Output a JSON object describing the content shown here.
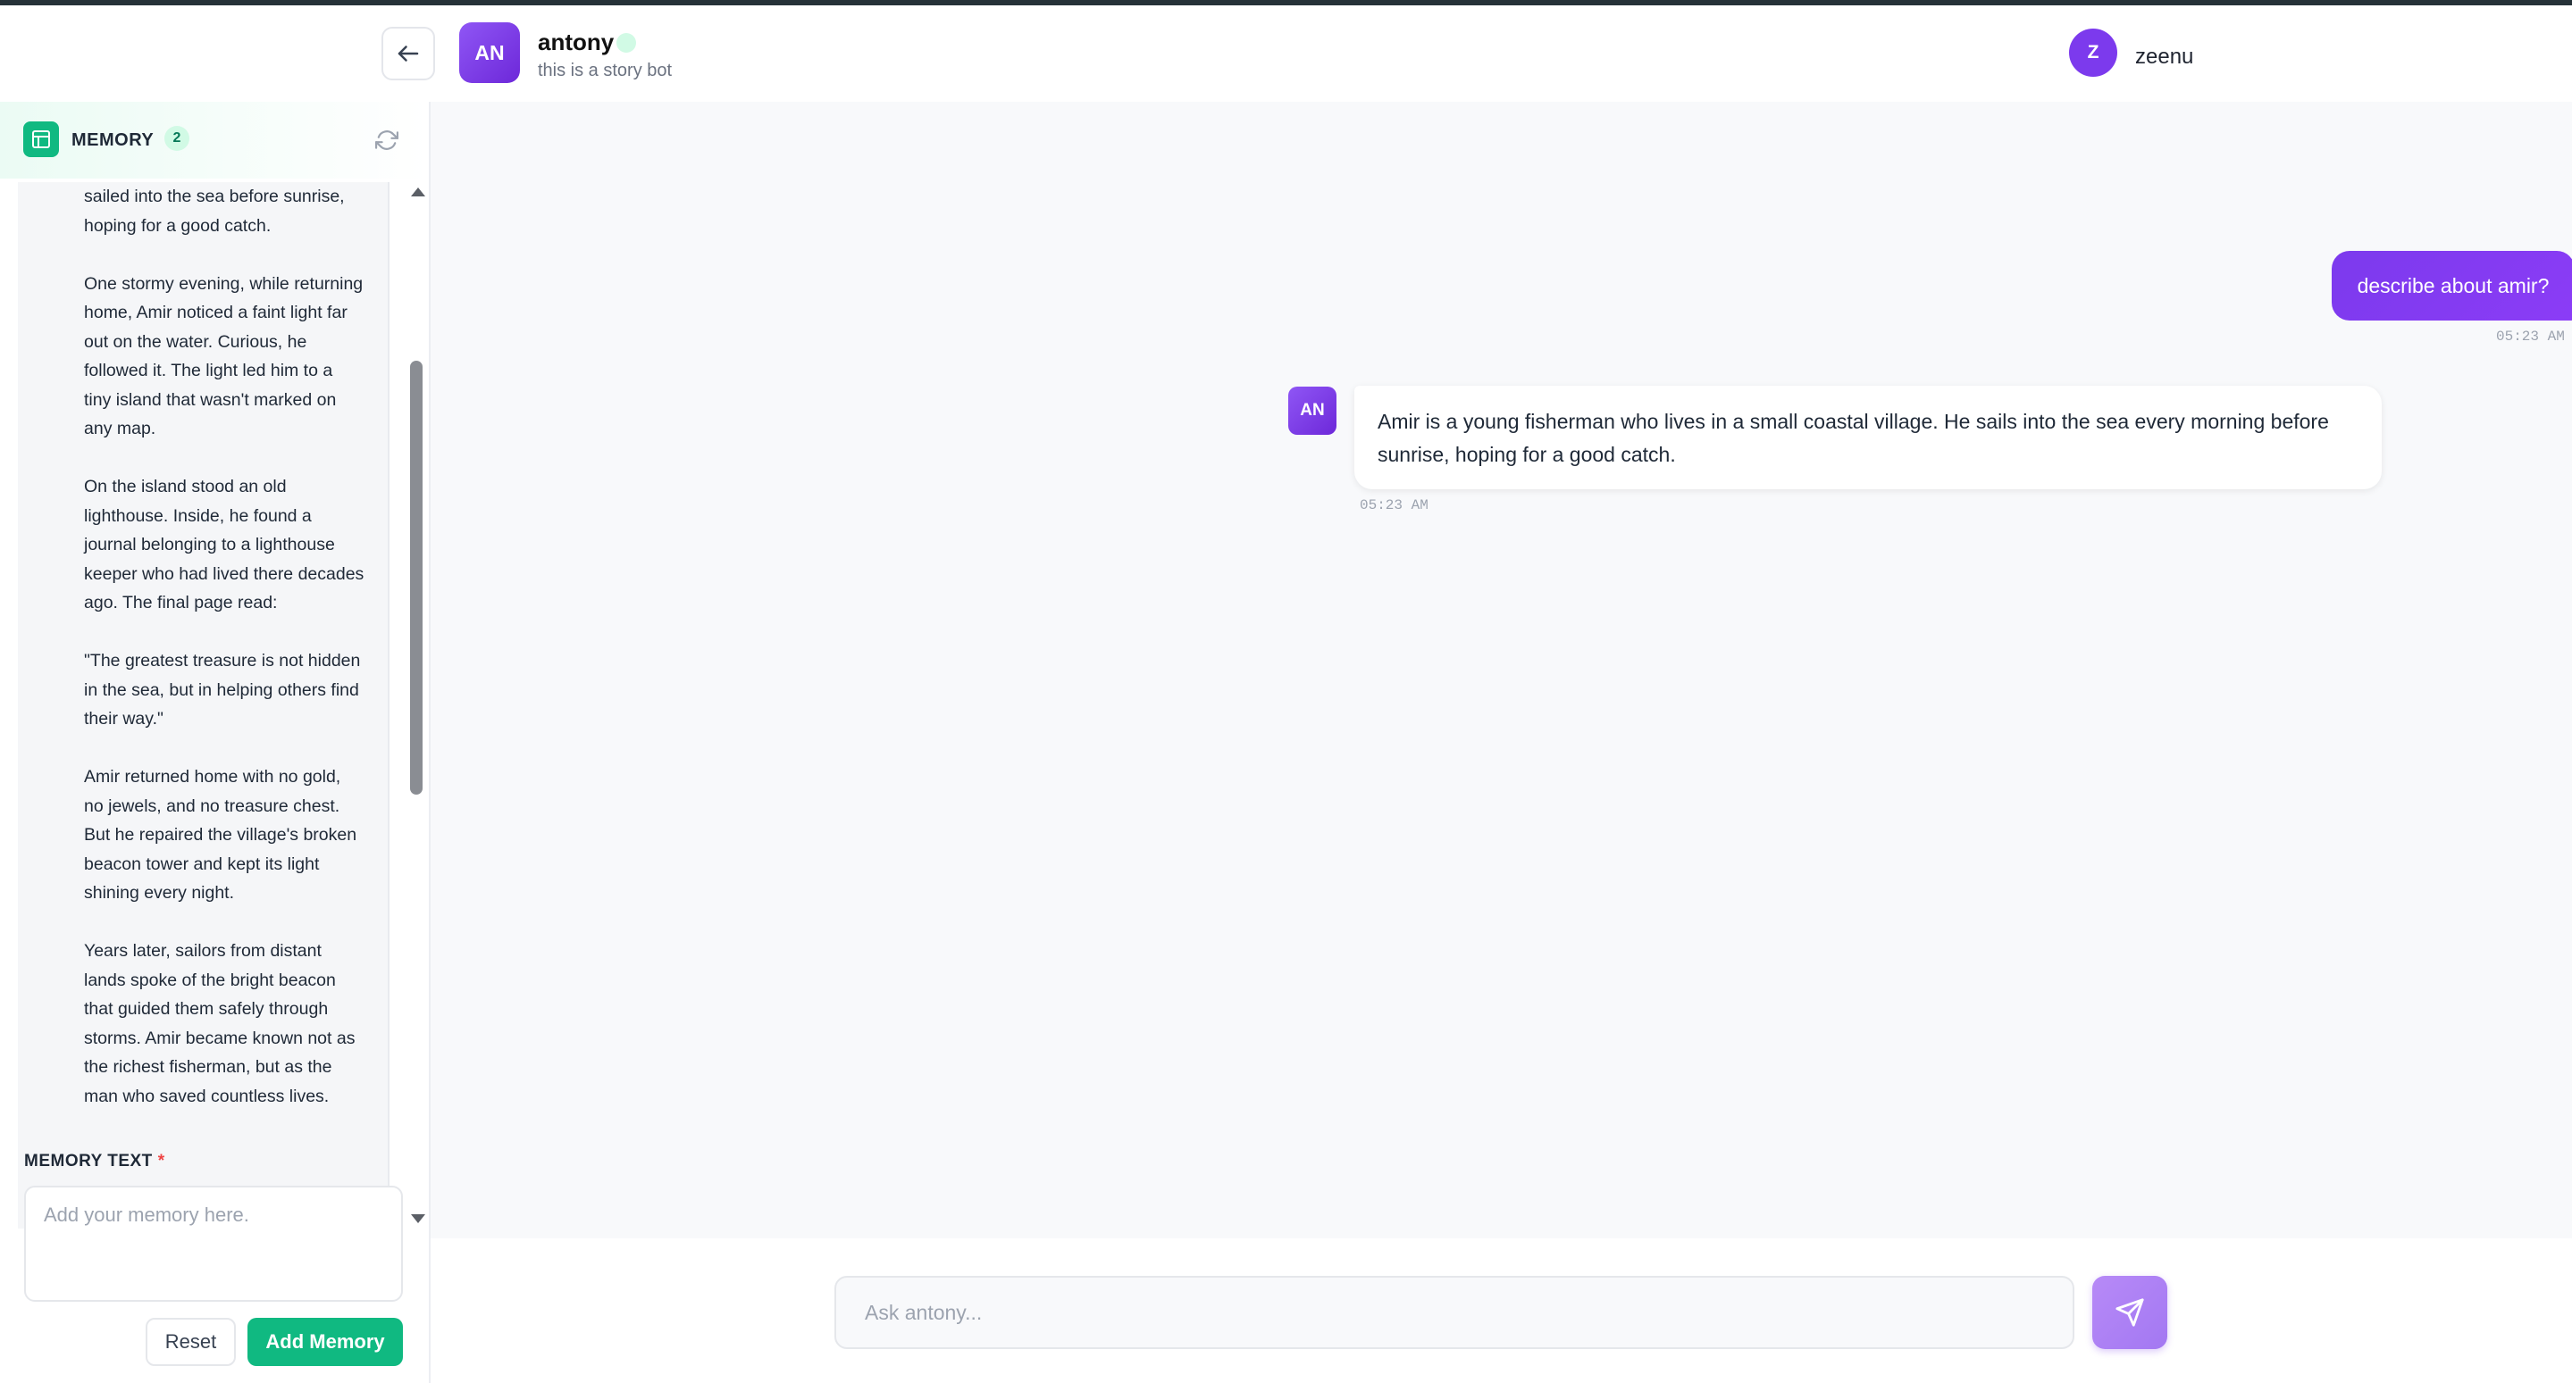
{
  "header": {
    "bot_initials": "AN",
    "bot_name": "antony",
    "bot_description": "this is a story bot",
    "user_initial": "Z",
    "user_name": "zeenu"
  },
  "memory": {
    "title": "MEMORY",
    "count": "2",
    "text": "sailed into the sea before sunrise,\nhoping for a good catch.\n\nOne stormy evening, while returning\nhome, Amir noticed a faint light far\nout on the water. Curious, he\nfollowed it. The light led him to a\ntiny island that wasn't marked on\nany map.\n\nOn the island stood an old\nlighthouse. Inside, he found a\njournal belonging to a lighthouse\nkeeper who had lived there decades\nago. The final page read:\n\n\"The greatest treasure is not hidden\nin the sea, but in helping others find\ntheir way.\"\n\nAmir returned home with no gold,\nno jewels, and no treasure chest.\nBut he repaired the village's broken\nbeacon tower and kept its light\nshining every night.\n\nYears later, sailors from distant\nlands spoke of the bright beacon\nthat guided them safely through\nstorms. Amir became known not as\nthe richest fisherman, but as the\nman who saved countless lives.",
    "form_label": "MEMORY TEXT",
    "required_mark": "*",
    "textarea_value": "",
    "textarea_placeholder": "Add your memory here.",
    "reset_label": "Reset",
    "add_label": "Add Memory"
  },
  "chat": {
    "messages": [
      {
        "role": "user",
        "text": "describe about amir?",
        "time": "05:23 AM"
      },
      {
        "role": "bot",
        "avatar": "AN",
        "text": "Amir is a young fisherman who lives in a small coastal village. He sails into the sea every morning before sunrise, hoping for a good catch.",
        "time": "05:23 AM"
      }
    ],
    "input_value": "",
    "input_placeholder": "Ask antony..."
  },
  "icons": {
    "back": "arrow-left-icon",
    "memory": "table-icon",
    "refresh": "refresh-icon",
    "send": "send-icon"
  },
  "colors": {
    "accent_purple": "#7c3aed",
    "accent_green": "#10b981"
  }
}
